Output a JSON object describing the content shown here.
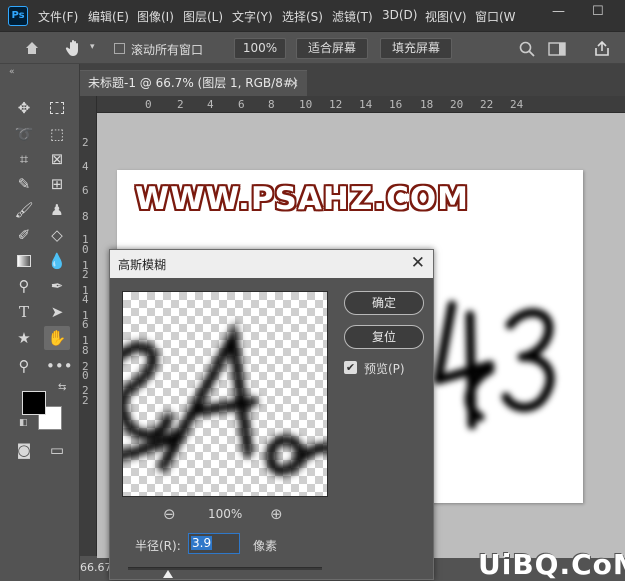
{
  "menubar": {
    "logo": "Ps",
    "items": [
      "文件(F)",
      "编辑(E)",
      "图像(I)",
      "图层(L)",
      "文字(Y)",
      "选择(S)",
      "滤镜(T)",
      "3D(D)",
      "视图(V)",
      "窗口(W"
    ],
    "minimize": "—",
    "maximize": "☐"
  },
  "options": {
    "scroll_all_windows": "滚动所有窗口",
    "zoom_value": "100%",
    "fit_screen": "适合屏幕",
    "fill_screen": "填充屏幕"
  },
  "document": {
    "tab_title": "未标题-1 @ 66.7% (图层 1, RGB/8#) *",
    "tab_close": "×",
    "watermark_text": "WWW.PSAHZ.COM",
    "blur_text": "43",
    "status_zoom": "66.67"
  },
  "ruler": {
    "top_ticks": [
      "0",
      "2",
      "4",
      "6",
      "8",
      "10",
      "12",
      "14",
      "16",
      "18",
      "20",
      "22",
      "24"
    ],
    "left_ticks": [
      "2",
      "4",
      "6",
      "8",
      "1",
      "0",
      "1",
      "2",
      "1",
      "4",
      "1",
      "6",
      "1",
      "8",
      "2",
      "0",
      "2",
      "2"
    ]
  },
  "dialog": {
    "title": "高斯模糊",
    "close": "✕",
    "ok": "确定",
    "reset": "复位",
    "preview_label": "预览(P)",
    "preview_checked": "✔",
    "preview_text": "SA",
    "zoom_value": "100%",
    "radius_label": "半径(R):",
    "radius_value": "3.9",
    "radius_unit": "像素"
  },
  "site_watermark": "UiBQ.CoM",
  "colors": {
    "foreground": "#000000",
    "background": "#ffffff",
    "accent": "#31a8ff",
    "watermark_outline": "#7a1a0f"
  }
}
